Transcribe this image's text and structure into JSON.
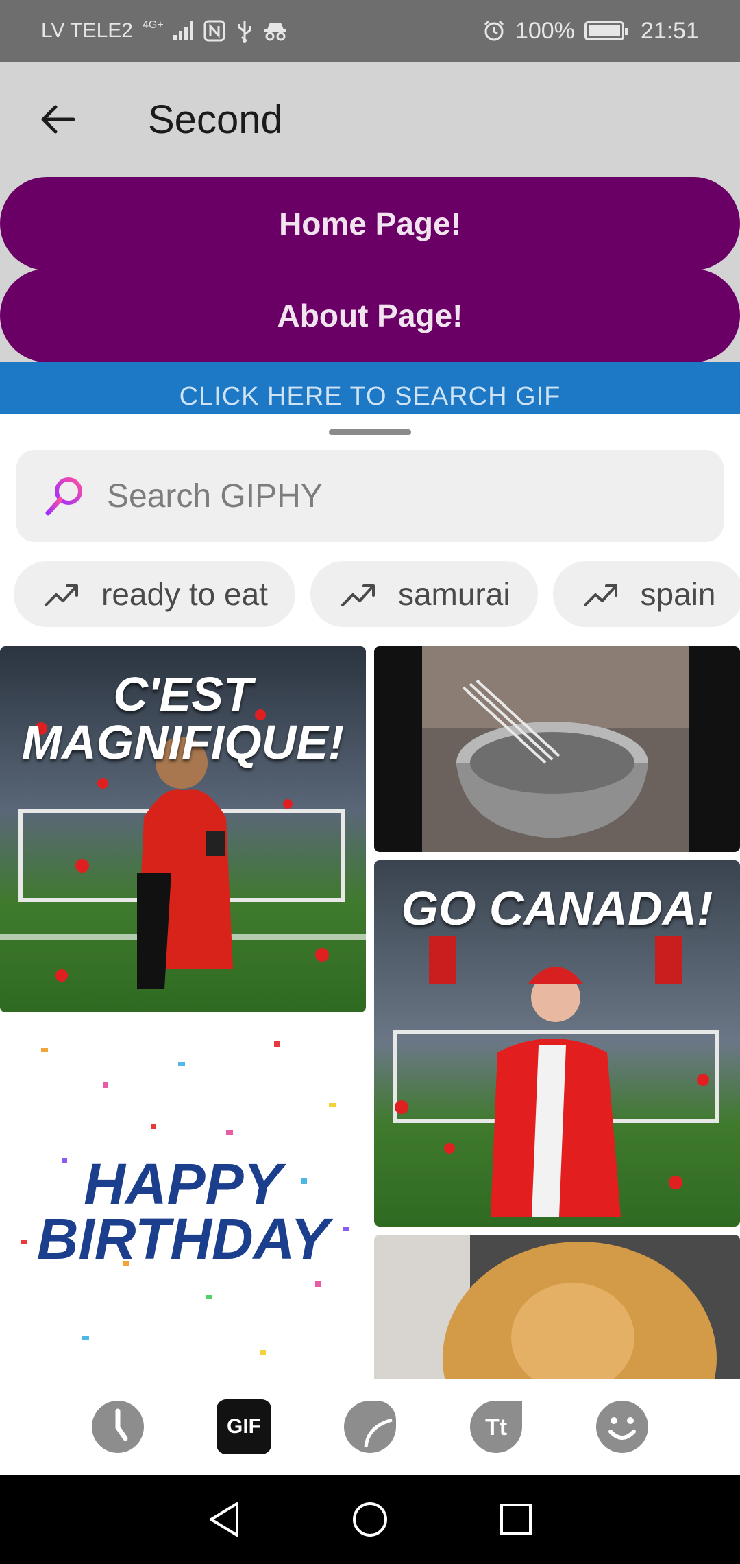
{
  "status_bar": {
    "carrier": "LV TELE2",
    "network": "4G+",
    "battery": "100%",
    "time": "21:51"
  },
  "app_bar": {
    "title": "Second"
  },
  "buttons": {
    "home": "Home Page!",
    "about": "About Page!",
    "search_gif": "CLICK HERE TO SEARCH GIF"
  },
  "sheet": {
    "search_placeholder": "Search GIPHY",
    "trending": [
      {
        "label": "ready to eat",
        "icon": "trending-icon"
      },
      {
        "label": "samurai",
        "icon": "trending-icon"
      },
      {
        "label": "spain",
        "icon": "trending-icon"
      }
    ],
    "gifs": [
      {
        "text_line1": "C'EST",
        "text_line2": "MAGNIFIQUE!"
      },
      {
        "text_line1": "",
        "text_line2": ""
      },
      {
        "text_line1": "GO CANADA!",
        "text_line2": ""
      },
      {
        "text_line1": "HAPPY",
        "text_line2": "BIRTHDAY"
      },
      {
        "text_line1": "",
        "text_line2": ""
      }
    ]
  },
  "tabs": {
    "gif_label": "GIF",
    "items": [
      "recents-icon",
      "gif-tab",
      "sticker-icon",
      "text-icon",
      "emoji-icon"
    ]
  },
  "colors": {
    "primary_button": "#6a0066",
    "search_button": "#1d78c5",
    "app_bar": "#d3d3d3"
  }
}
